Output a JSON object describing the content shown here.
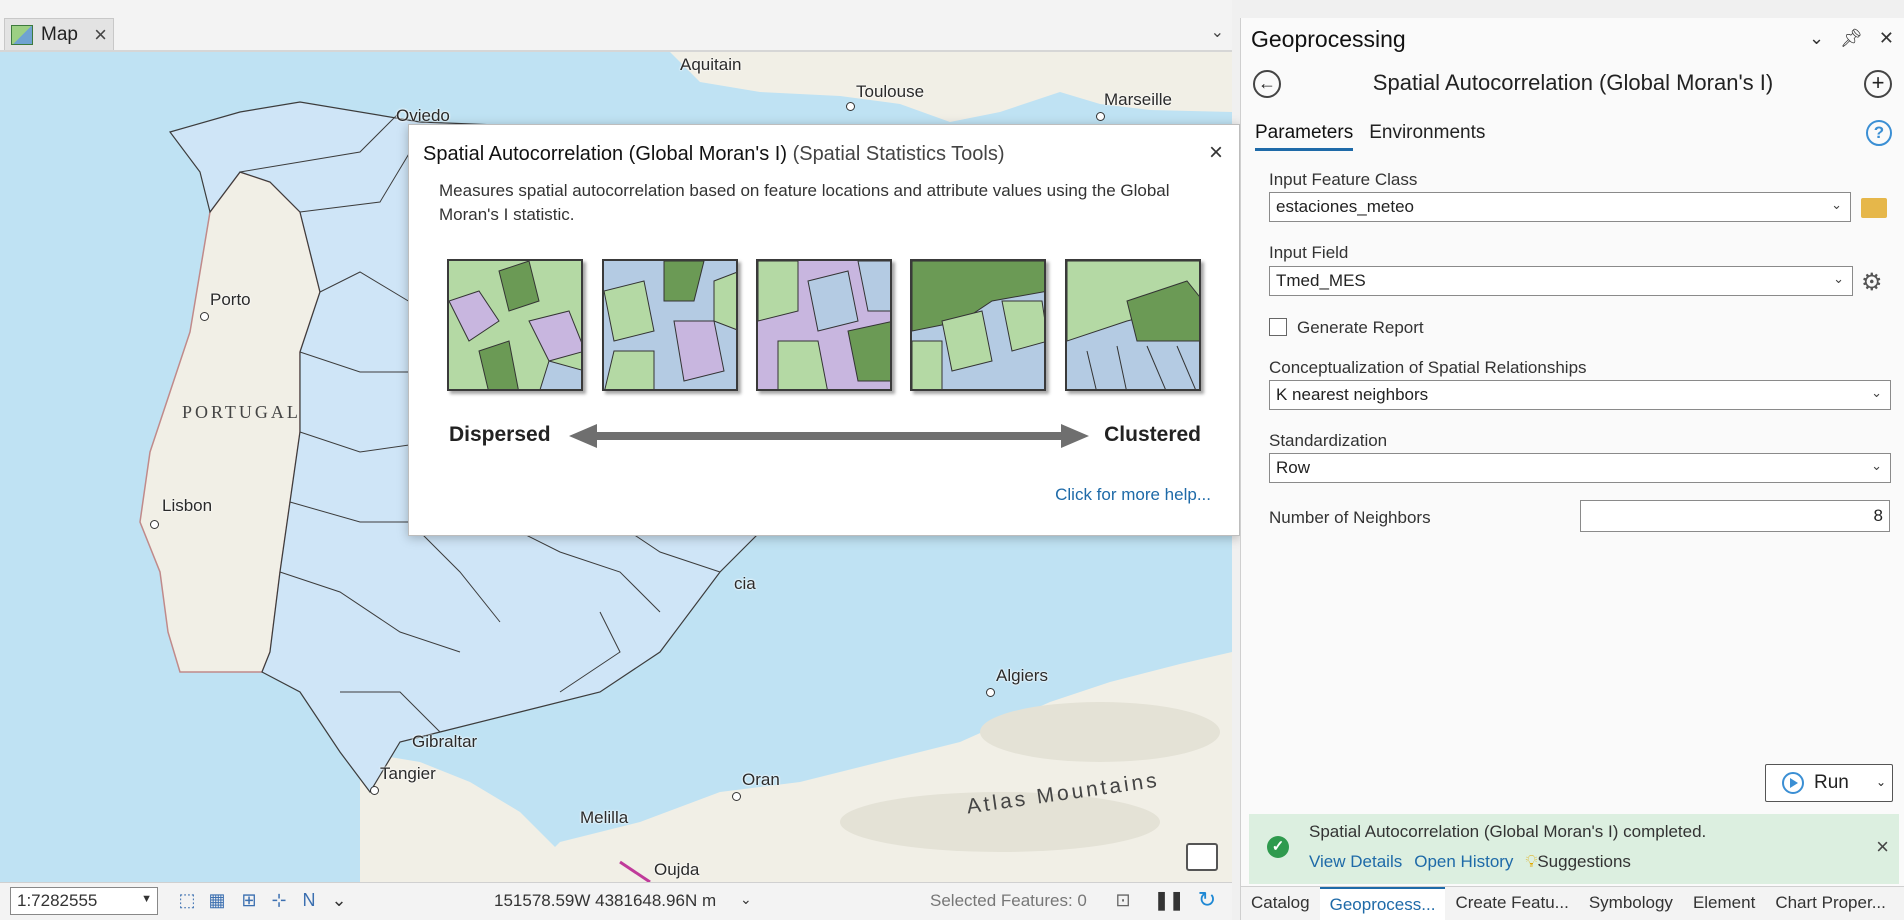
{
  "map_tab": {
    "label": "Map"
  },
  "map": {
    "cities": [
      "Aquitain",
      "Toulouse",
      "Marseille",
      "Oviedo",
      "Porto",
      "Lisbon",
      "Gibraltar",
      "Tangier",
      "Melilla",
      "Oujda",
      "Oran",
      "Algiers",
      "cia"
    ],
    "regions": [
      "PORTUGAL",
      "Atlas Mountains"
    ]
  },
  "popup": {
    "title": "Spatial Autocorrelation (Global Moran's I)",
    "subtitle": "(Spatial Statistics Tools)",
    "description": "Measures spatial autocorrelation based on feature locations and attribute values using the Global Moran's I statistic.",
    "left_label": "Dispersed",
    "right_label": "Clustered",
    "help_link": "Click for more help..."
  },
  "statusbar": {
    "scale": "1:7282555",
    "coordinates": "151578.59W 4381648.96N m",
    "selected_features": "Selected Features: 0"
  },
  "gp": {
    "title": "Geoprocessing",
    "tool_title": "Spatial Autocorrelation (Global Moran's I)",
    "tabs": [
      "Parameters",
      "Environments"
    ],
    "input_feature_class_label": "Input Feature Class",
    "input_feature_class_value": "estaciones_meteo",
    "input_field_label": "Input Field",
    "input_field_value": "Tmed_MES",
    "generate_report_label": "Generate Report",
    "conceptualization_label": "Conceptualization of Spatial Relationships",
    "conceptualization_value": "K nearest neighbors",
    "standardization_label": "Standardization",
    "standardization_value": "Row",
    "neighbors_label": "Number of Neighbors",
    "neighbors_value": "8",
    "run_label": "Run",
    "message": "Spatial Autocorrelation (Global Moran's I) completed.",
    "view_details": "View Details",
    "open_history": "Open History",
    "suggestions": "Suggestions"
  },
  "bottom_tabs": [
    "Catalog",
    "Geoprocess...",
    "Create Featu...",
    "Symbology",
    "Element",
    "Chart Proper..."
  ],
  "colors": {
    "accent": "#1e6aa8",
    "success": "#2f9a4e",
    "land": "#f1efe6",
    "region_fill": "#cfe5f7",
    "sea": "#bfe2f3"
  }
}
